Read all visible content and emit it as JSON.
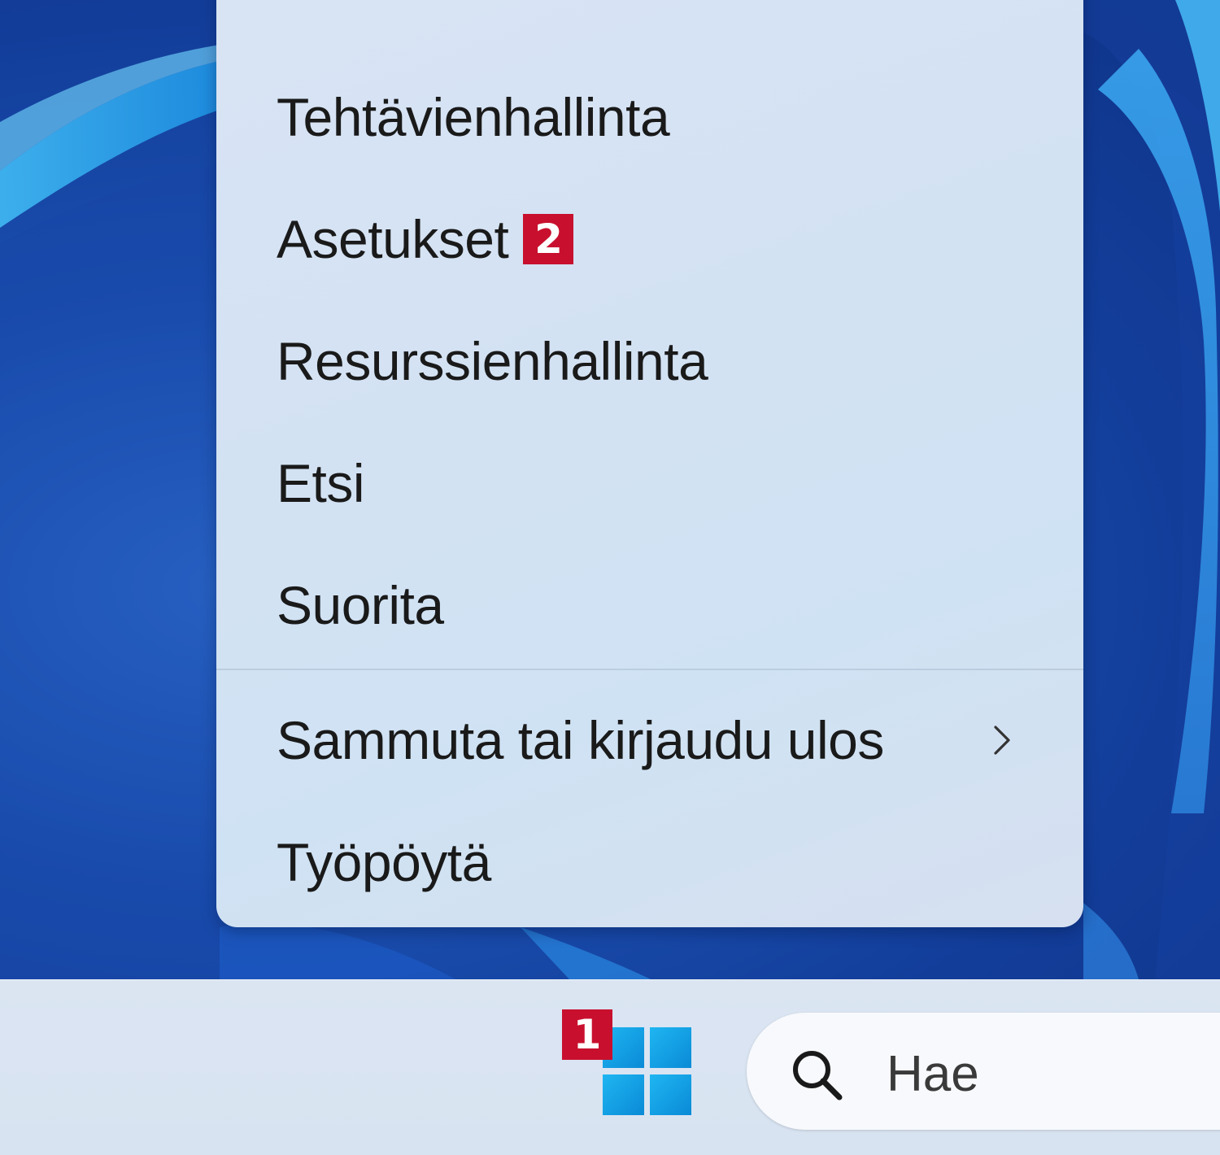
{
  "context_menu": {
    "items": [
      {
        "label": "Tehtävienhallinta"
      },
      {
        "label": "Asetukset",
        "badge": "2"
      },
      {
        "label": "Resurssienhallinta"
      },
      {
        "label": "Etsi"
      },
      {
        "label": "Suorita"
      },
      {
        "label": "Sammuta tai kirjaudu ulos",
        "has_submenu": true
      },
      {
        "label": "Työpöytä"
      }
    ]
  },
  "taskbar": {
    "start_badge": "1",
    "search_placeholder": "Hae"
  },
  "colors": {
    "badge": "#c8102e",
    "windows_logo": "#0a8ad6"
  }
}
